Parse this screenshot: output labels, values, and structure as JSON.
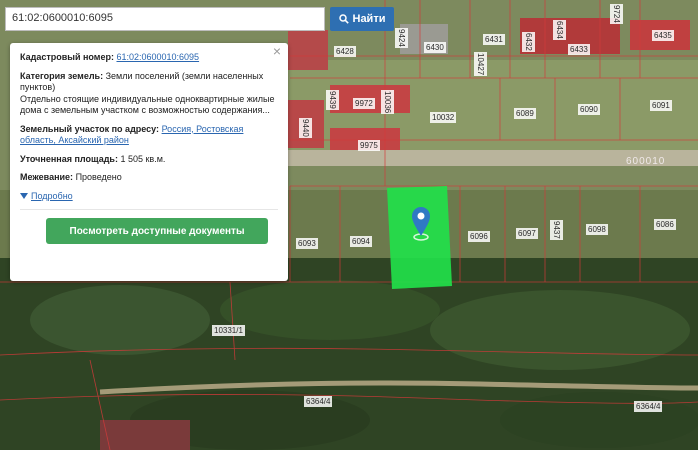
{
  "search": {
    "value": "61:02:0600010:6095",
    "button_label": "Найти"
  },
  "popup": {
    "cadastral_label": "Кадастровый номер:",
    "cadastral_value": "61:02:0600010:6095",
    "category_label": "Категория земель:",
    "category_value": "Земли поселений (земли населенных пунктов)",
    "usage_text": "Отдельно стоящие индивидуальные одноквартирные жилые дома с земельным участком с возможностью содержания...",
    "address_label": "Земельный участок по адресу:",
    "address_value": "Россия, Ростовская область, Аксайский район",
    "area_label": "Уточненная площадь:",
    "area_value": "1 505 кв.м.",
    "survey_label": "Межевание:",
    "survey_value": "Проведено",
    "details_label": "Подробно",
    "docs_button": "Посмотреть доступные документы",
    "close_icon": "×"
  },
  "parcels": {
    "p6428": "6428",
    "p6430": "6430",
    "p6431": "6431",
    "p6432": "6432",
    "p6433": "6433",
    "p6434": "6434",
    "p6435": "6435",
    "p10032": "10032",
    "p6089": "6089",
    "p6090": "6090",
    "p6091": "6091",
    "p6093": "6093",
    "p6094": "6094",
    "p6096": "6096",
    "p6097": "6097",
    "p6098": "6098",
    "p6086": "6086",
    "p10331": "10331/1",
    "p6364a": "6364/4",
    "p6364b": "6364/4",
    "p600010": "600010",
    "p9972": "9972",
    "p9975": "9975",
    "v1": "9424",
    "v2": "10036",
    "v3": "9439",
    "v4": "9440",
    "v5": "10427",
    "v6": "9437",
    "v7": "9724"
  },
  "colors": {
    "accent": "#2e6fb2",
    "button_green": "#42a65c",
    "parcel_fill": "#22e04a",
    "boundary": "#d23a3a"
  }
}
